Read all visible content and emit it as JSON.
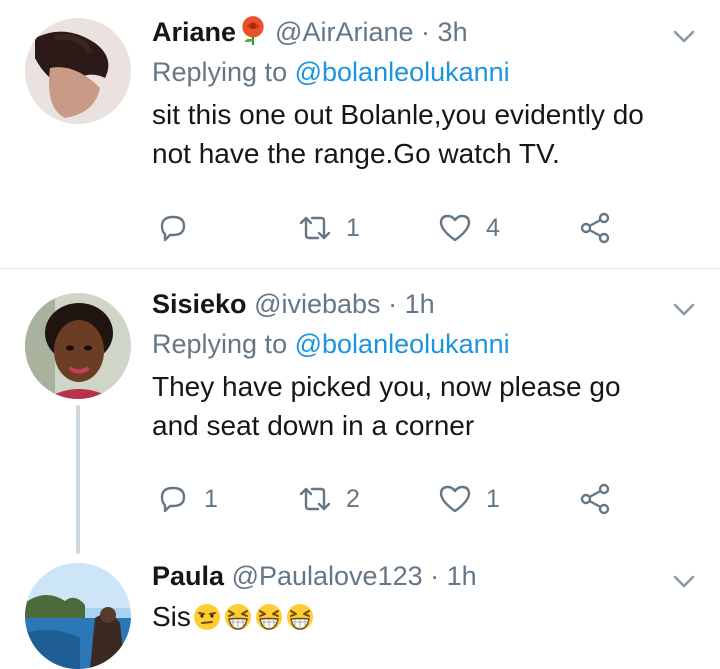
{
  "tweets": [
    {
      "name": "Ariane",
      "name_emoji": "rose-emoji",
      "handle": "@AirAriane",
      "separator": "·",
      "time": "3h",
      "replying_prefix": "Replying to",
      "replying_mention": "@bolanleolukanni",
      "text": "sit this one out Bolanle,you evidently do not have the range.Go watch TV.",
      "reply_count": "",
      "retweet_count": "1",
      "like_count": "4"
    },
    {
      "name": "Sisieko",
      "handle": "@iviebabs",
      "separator": "·",
      "time": "1h",
      "replying_prefix": "Replying to",
      "replying_mention": "@bolanleolukanni",
      "text": "They have picked you, now please go and seat down in a corner",
      "reply_count": "1",
      "retweet_count": "2",
      "like_count": "1"
    },
    {
      "name": "Paula",
      "handle": "@Paulalove123",
      "separator": "·",
      "time": "1h",
      "text": "Sis",
      "text_emojis": [
        "unamused-face-emoji",
        "grinning-squinting-face-emoji",
        "grinning-squinting-face-emoji",
        "grinning-squinting-face-emoji"
      ]
    }
  ],
  "icons": {
    "reply": "reply-icon",
    "retweet": "retweet-icon",
    "like": "heart-icon",
    "share": "share-icon",
    "menu": "chevron-down-icon"
  },
  "colors": {
    "text": "#14171a",
    "secondary": "#657786",
    "link": "#1b95e0",
    "divider": "#e1e8ed",
    "thread_line": "#ccd6dd"
  }
}
